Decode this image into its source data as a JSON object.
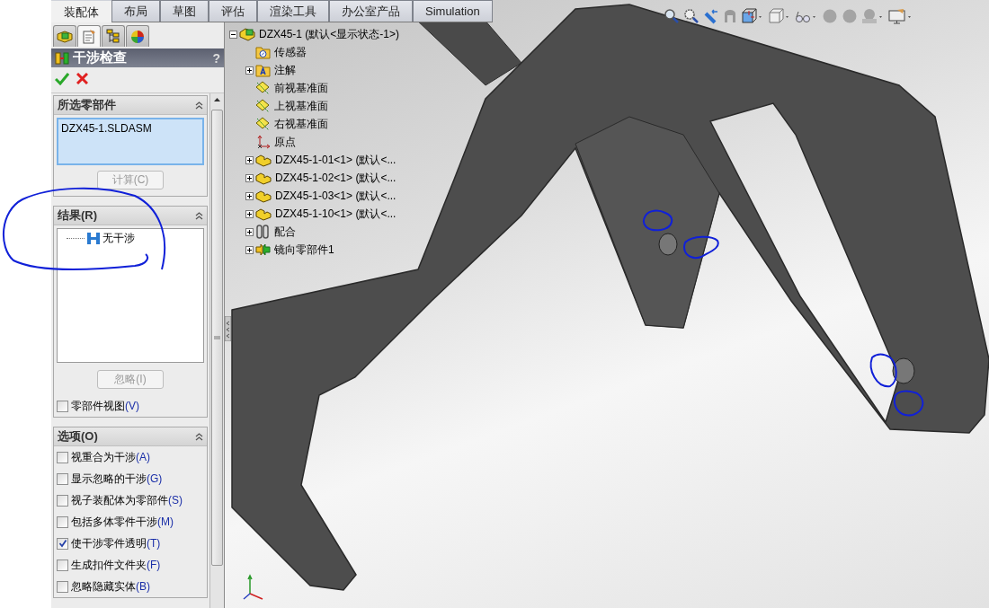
{
  "command_tabs": [
    {
      "label": "装配体",
      "selected": true
    },
    {
      "label": "布局",
      "selected": false
    },
    {
      "label": "草图",
      "selected": false
    },
    {
      "label": "评估",
      "selected": false
    },
    {
      "label": "渲染工具",
      "selected": false
    },
    {
      "label": "办公室产品",
      "selected": false
    },
    {
      "label": "Simulation",
      "selected": false
    }
  ],
  "panel_tabs": [
    {
      "kind": "feature-manager",
      "selected": false
    },
    {
      "kind": "property-manager",
      "selected": true
    },
    {
      "kind": "configuration-manager",
      "selected": false
    },
    {
      "kind": "appearance-manager",
      "selected": false
    }
  ],
  "property_manager": {
    "title": "干涉检查",
    "help": "?",
    "selected_components": {
      "title": "所选零部件",
      "items": [
        "DZX45-1.SLDASM"
      ],
      "button": {
        "label": "计算(C)",
        "disabled": true
      }
    },
    "results": {
      "title": "结果(R)",
      "items": [
        {
          "label": "无干涉"
        }
      ],
      "button": {
        "label": "忽略(I)",
        "disabled": true
      },
      "checkbox": {
        "label": "零部件视图",
        "shortcut": "(V)",
        "checked": false
      }
    },
    "options": {
      "title": "选项(O)",
      "checkboxes": [
        {
          "label": "视重合为干涉",
          "shortcut": "(A)",
          "checked": false
        },
        {
          "label": "显示忽略的干涉",
          "shortcut": "(G)",
          "checked": false
        },
        {
          "label": "视子装配体为零部件",
          "shortcut": "(S)",
          "checked": false
        },
        {
          "label": "包括多体零件干涉",
          "shortcut": "(M)",
          "checked": false
        },
        {
          "label": "使干涉零件透明",
          "shortcut": "(T)",
          "checked": true
        },
        {
          "label": "生成扣件文件夹",
          "shortcut": "(F)",
          "checked": false
        },
        {
          "label": "忽略隐藏实体",
          "shortcut": "(B)",
          "checked": false
        }
      ]
    }
  },
  "feature_tree": {
    "items": [
      {
        "label": "DZX45-1  (默认<显示状态-1>)",
        "kind": "assembly",
        "expanded": true,
        "children": [
          {
            "label": "传感器",
            "kind": "sensor-folder"
          },
          {
            "label": "注解",
            "kind": "annotation-folder",
            "expanded": false
          },
          {
            "label": "前视基准面",
            "kind": "plane"
          },
          {
            "label": "上视基准面",
            "kind": "plane"
          },
          {
            "label": "右视基准面",
            "kind": "plane"
          },
          {
            "label": "原点",
            "kind": "origin"
          },
          {
            "label": "DZX45-1-01<1>  (默认<...",
            "kind": "part",
            "expanded": false
          },
          {
            "label": "DZX45-1-02<1>  (默认<...",
            "kind": "part",
            "expanded": false
          },
          {
            "label": "DZX45-1-03<1>  (默认<...",
            "kind": "part",
            "expanded": false
          },
          {
            "label": "DZX45-1-10<1>  (默认<...",
            "kind": "part",
            "expanded": false
          },
          {
            "label": "配合",
            "kind": "mates",
            "expanded": false
          },
          {
            "label": "镜向零部件1",
            "kind": "mirror",
            "expanded": false
          }
        ]
      }
    ]
  }
}
